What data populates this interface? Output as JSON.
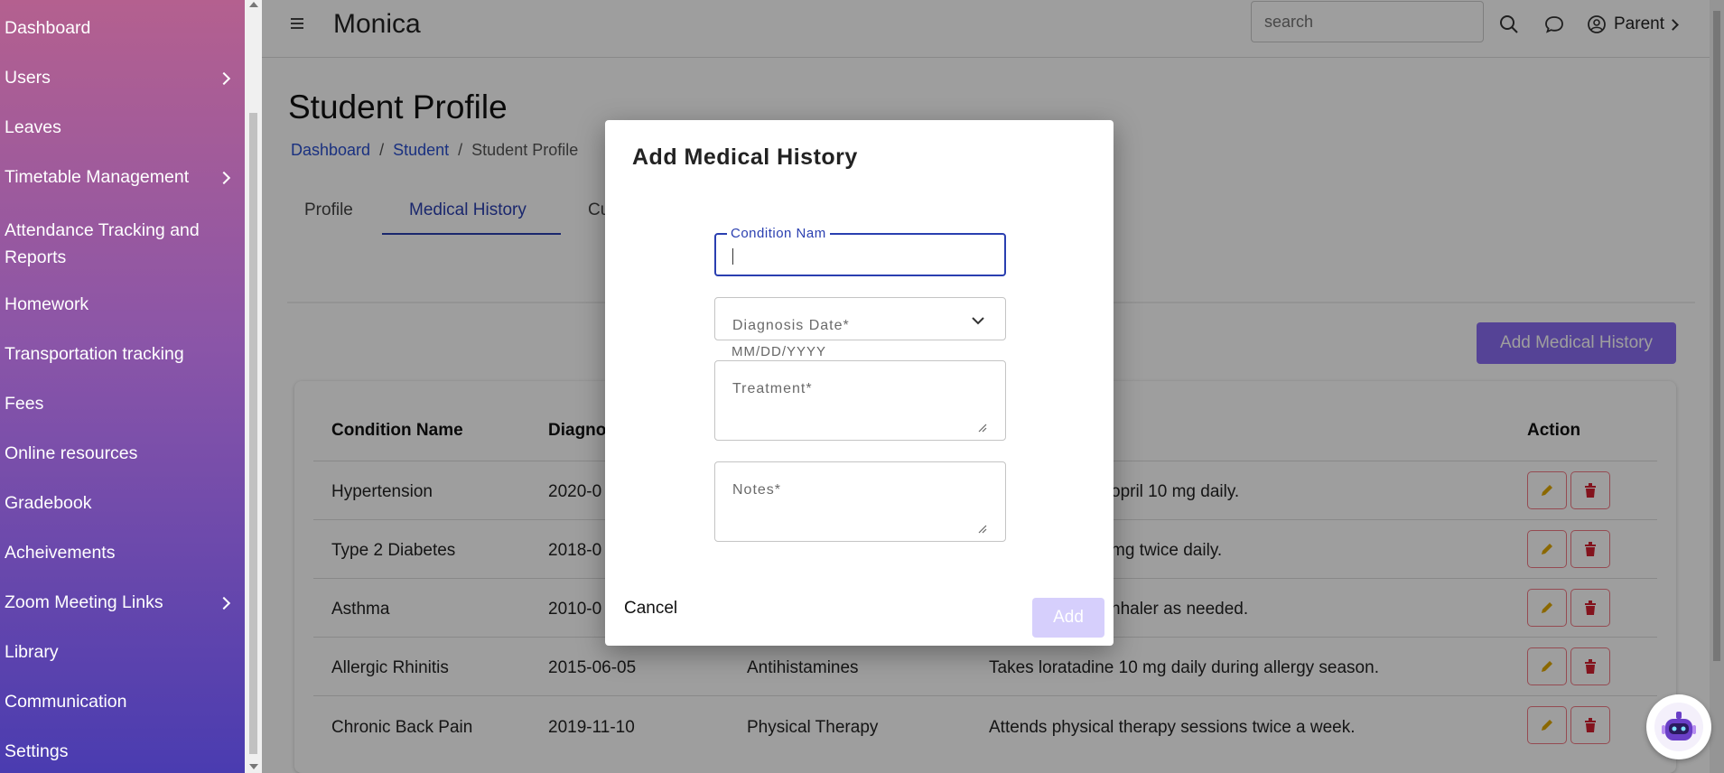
{
  "sidebar": {
    "items": [
      {
        "label": "Dashboard",
        "has_chevron": false
      },
      {
        "label": "Users",
        "has_chevron": true
      },
      {
        "label": "Leaves",
        "has_chevron": false
      },
      {
        "label": "Timetable Management",
        "has_chevron": true
      },
      {
        "label": "Attendance Tracking and Reports",
        "has_chevron": false
      },
      {
        "label": "Homework",
        "has_chevron": false
      },
      {
        "label": "Transportation tracking",
        "has_chevron": false
      },
      {
        "label": "Fees",
        "has_chevron": false
      },
      {
        "label": "Online resources",
        "has_chevron": false
      },
      {
        "label": "Gradebook",
        "has_chevron": false
      },
      {
        "label": "Acheivements",
        "has_chevron": false
      },
      {
        "label": "Zoom Meeting Links",
        "has_chevron": true
      },
      {
        "label": "Library",
        "has_chevron": false
      },
      {
        "label": "Communication",
        "has_chevron": false
      },
      {
        "label": "Settings",
        "has_chevron": false
      }
    ]
  },
  "header": {
    "app_title": "Monica",
    "search_placeholder": "search",
    "user_label": "Parent"
  },
  "page": {
    "title": "Student Profile",
    "breadcrumb": [
      "Dashboard",
      "Student",
      "Student Profile"
    ],
    "breadcrumb_sep": "/",
    "tabs": [
      "Profile",
      "Medical History",
      "Cu"
    ],
    "active_tab": "Medical History",
    "add_button": "Add Medical History"
  },
  "table": {
    "headers": [
      "Condition Name",
      "Diagno",
      "Action"
    ],
    "rows": [
      {
        "condition": "Hypertension",
        "date": "2020-0",
        "treatment": "",
        "notes": "opril 10 mg daily."
      },
      {
        "condition": "Type 2 Diabetes",
        "date": "2018-0",
        "treatment": "",
        "notes": "mg twice daily."
      },
      {
        "condition": "Asthma",
        "date": "2010-0",
        "treatment": "",
        "notes": "nhaler as needed."
      },
      {
        "condition": "Allergic Rhinitis",
        "date": "2015-06-05",
        "treatment": "Antihistamines",
        "notes": "Takes loratadine 10 mg daily during allergy season."
      },
      {
        "condition": "Chronic Back Pain",
        "date": "2019-11-10",
        "treatment": "Physical Therapy",
        "notes": "Attends physical therapy sessions twice a week."
      }
    ]
  },
  "dialog": {
    "title": "Add Medical History",
    "condition_label": "Condition Nam",
    "condition_value": "",
    "diagnosis_placeholder": "Diagnosis Date*",
    "diagnosis_helper": "MM/DD/YYYY",
    "treatment_placeholder": "Treatment*",
    "notes_placeholder": "Notes*",
    "cancel_label": "Cancel",
    "add_label": "Add"
  },
  "colors": {
    "accent": "#2a3fb0",
    "add_button": "#8a6cf2",
    "delete_icon": "#d3202f",
    "edit_icon": "#e0a800"
  }
}
